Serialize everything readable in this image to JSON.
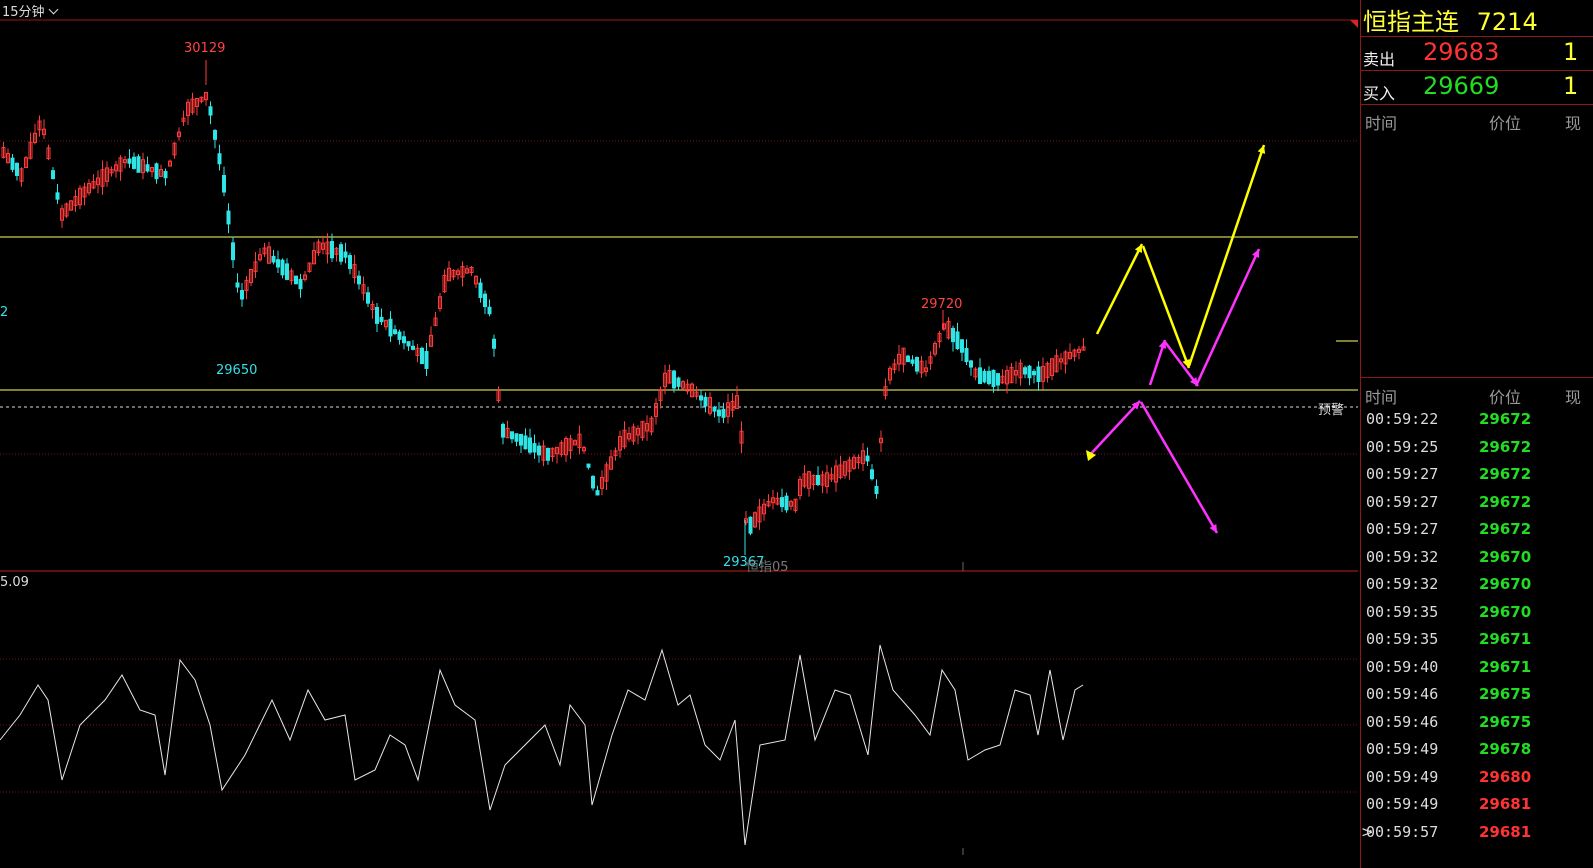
{
  "toolbar": {
    "period_label": "15分钟"
  },
  "chart": {
    "price_labels": {
      "high": "30129",
      "low1": "29650",
      "high2": "29720",
      "low2": "29367",
      "left_edge": "2"
    },
    "alert_label": "预警",
    "watermark": "恒指05",
    "indicator_value": "5.09",
    "colors": {
      "up": "#ff3b3b",
      "down": "#2ee6e6",
      "support_line": "#ffff66",
      "yellow_arrow": "#ffff00",
      "magenta_arrow": "#ff33ff"
    }
  },
  "quote": {
    "title": "恒指主连",
    "title_number": "7214",
    "sell_label": "卖出",
    "sell_price": "29683",
    "sell_vol": "1",
    "buy_label": "买入",
    "buy_price": "29669",
    "buy_vol": "1"
  },
  "table_top": {
    "col_time": "时间",
    "col_price": "价位",
    "col_vol": "现"
  },
  "table_bottom": {
    "col_time": "时间",
    "col_price": "价位",
    "col_vol": "现"
  },
  "ticks": [
    {
      "time": "00:59:22",
      "price": "29672",
      "color": "g"
    },
    {
      "time": "00:59:25",
      "price": "29672",
      "color": "g"
    },
    {
      "time": "00:59:27",
      "price": "29672",
      "color": "g"
    },
    {
      "time": "00:59:27",
      "price": "29672",
      "color": "g"
    },
    {
      "time": "00:59:27",
      "price": "29672",
      "color": "g"
    },
    {
      "time": "00:59:32",
      "price": "29670",
      "color": "g"
    },
    {
      "time": "00:59:32",
      "price": "29670",
      "color": "g"
    },
    {
      "time": "00:59:35",
      "price": "29670",
      "color": "g"
    },
    {
      "time": "00:59:35",
      "price": "29671",
      "color": "g"
    },
    {
      "time": "00:59:40",
      "price": "29671",
      "color": "g"
    },
    {
      "time": "00:59:46",
      "price": "29675",
      "color": "g"
    },
    {
      "time": "00:59:46",
      "price": "29675",
      "color": "g"
    },
    {
      "time": "00:59:49",
      "price": "29678",
      "color": "g"
    },
    {
      "time": "00:59:49",
      "price": "29680",
      "color": "r"
    },
    {
      "time": "00:59:49",
      "price": "29681",
      "color": "r"
    },
    {
      "time": "00:59:57",
      "price": "29681",
      "color": "r",
      "current": true
    }
  ]
}
